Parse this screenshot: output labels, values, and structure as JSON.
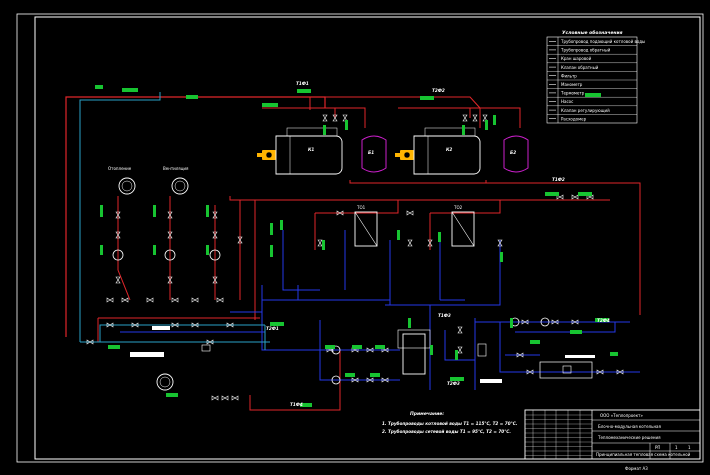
{
  "drawing": {
    "title": "Принципиальная тепловая схема котельной",
    "notes_heading": "Примечание:",
    "notes": [
      "1. Трубопроводы котловой воды Т1 = 115°С, Т2 = 70°С.",
      "2. Трубопроводы сетевой воды Т1 = 95°С, Т2 = 70°С."
    ]
  },
  "legend": {
    "title": "Условные обозначения",
    "items": [
      "Трубопровод подающий котловой воды",
      "Трубопровод обратный",
      "Кран шаровой",
      "Клапан обратный",
      "Фильтр",
      "Манометр",
      "Термометр",
      "Насос",
      "Клапан регулирующий",
      "Расходомер"
    ]
  },
  "equipment": {
    "boiler_1": "К1",
    "boiler_2": "К2",
    "tank_1": "Б1",
    "tank_2": "Б2",
    "heat_exchanger_1": "ТО1",
    "heat_exchanger_2": "ТО2",
    "consumer_1": "Отопление",
    "consumer_2": "Вентиляция"
  },
  "pipe_labels": [
    "Т1Ф1",
    "Т2Ф2",
    "Т1Ф2",
    "Т2Ф1",
    "Т1Ф3",
    "Т2Ф3",
    "Т1Ф4",
    "Т2Ф4"
  ],
  "title_block": {
    "organization": "ООО «Теплопроект»",
    "project": "Блочно-модульная котельная",
    "sheet_name": "Тепломеханические решения",
    "stage": "РП",
    "sheet": "1",
    "sheets": "1",
    "format": "Формат А3"
  },
  "colors": {
    "supply": "#e0262a",
    "return": "#2438e8",
    "cold_water": "#2aa2c8",
    "tags": "#17c431",
    "burner": "#ffb400",
    "tank": "#cc1fcc",
    "frame": "#ffffff"
  }
}
